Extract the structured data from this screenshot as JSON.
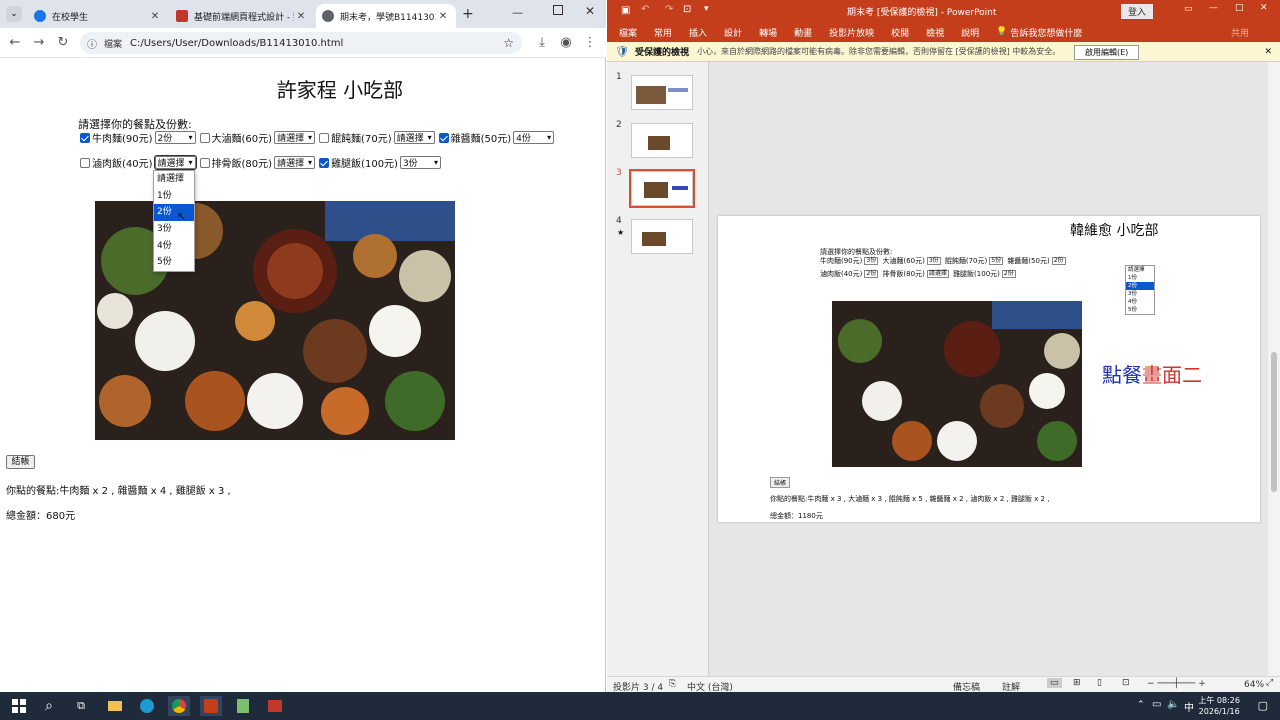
{
  "chrome": {
    "tabs": [
      {
        "title": "在校學生",
        "color": "#1a73e8"
      },
      {
        "title": "基礎前端網頁程式設計 - 劉",
        "color": "#c0392b"
      },
      {
        "title": "期末考，學號B11413010",
        "color": "#5f6368"
      }
    ],
    "new_tab": "+",
    "url_chip": "檔案",
    "url": "C:/Users/User/Downloads/B11413010.html"
  },
  "order_page": {
    "title": "許家程 小吃部",
    "prompt": "請選擇你的餐點及份數:",
    "items": [
      {
        "name": "牛肉麵(90元)",
        "checked": true,
        "qty": "2份"
      },
      {
        "name": "大滷麵(60元)",
        "checked": false,
        "qty": "請選擇"
      },
      {
        "name": "餛飩麵(70元)",
        "checked": false,
        "qty": "請選擇"
      },
      {
        "name": "雜醬麵(50元)",
        "checked": true,
        "qty": "4份"
      },
      {
        "name": "滷肉飯(40元)",
        "checked": false,
        "qty": "請選擇"
      },
      {
        "name": "排骨飯(80元)",
        "checked": false,
        "qty": "請選擇"
      },
      {
        "name": "雞腿飯(100元)",
        "checked": true,
        "qty": "3份"
      }
    ],
    "dropdown_options": [
      "請選擇",
      "1份",
      "2份",
      "3份",
      "4份",
      "5份"
    ],
    "dropdown_highlight": 2,
    "checkout_button": "結帳",
    "result_text": "你點的餐點:牛肉麵 x 2 , 雜醬麵 x 4 , 雞腿飯 x 3 ,",
    "total_text": "總金額：680元"
  },
  "ppt": {
    "title": "期末考 [受保護的檢視] - PowerPoint",
    "sign_in": "登入",
    "share": "共用",
    "ribbon_tabs": [
      "檔案",
      "常用",
      "插入",
      "設計",
      "轉場",
      "動畫",
      "投影片放映",
      "校閱",
      "檢視",
      "說明"
    ],
    "tell_me": "告訴我您想做什麼",
    "warning_title": "受保護的檢視",
    "warning_text": "小心，來自於網際網路的檔案可能有病毒。除非您需要編輯，否則停留在 [受保護的檢視] 中較為安全。",
    "enable_edit": "啟用編輯(E)",
    "slide_numbers": [
      "1",
      "2",
      "3",
      "4"
    ],
    "slide": {
      "title": "韓維愈 小吃部",
      "prompt": "請選擇你的餐點及份數:",
      "row1": [
        "牛肉麵(90元)",
        "3份",
        "大滷麵(60元)",
        "3份",
        "餛飩麵(70元)",
        "5份",
        "雜醬麵(50元)",
        "2份"
      ],
      "row2": [
        "滷肉飯(40元)",
        "2份",
        "排骨飯(80元)",
        "請選擇",
        "雞腿飯(100元)",
        "2份"
      ],
      "dropdown_options": [
        "請選擇",
        "1份",
        "2份",
        "3份",
        "4份",
        "5份"
      ],
      "caption_a": "點餐",
      "caption_b": "畫面二",
      "button": "結帳",
      "result": "你點的餐點:牛肉麵 x 3 , 大滷麵 x 3 , 餛飩麵 x 5 , 雜醬麵 x 2 , 滷肉飯 x 2 , 雞腿飯 x 2 ,",
      "total": "總金額：1180元"
    },
    "status_slide": "投影片 3 / 4",
    "status_lang": "中文 (台灣)",
    "status_notes": "備忘稿",
    "status_comments": "註解",
    "zoom": "64%"
  },
  "taskbar": {
    "time": "上午 08:26",
    "date": "2026/1/16"
  }
}
